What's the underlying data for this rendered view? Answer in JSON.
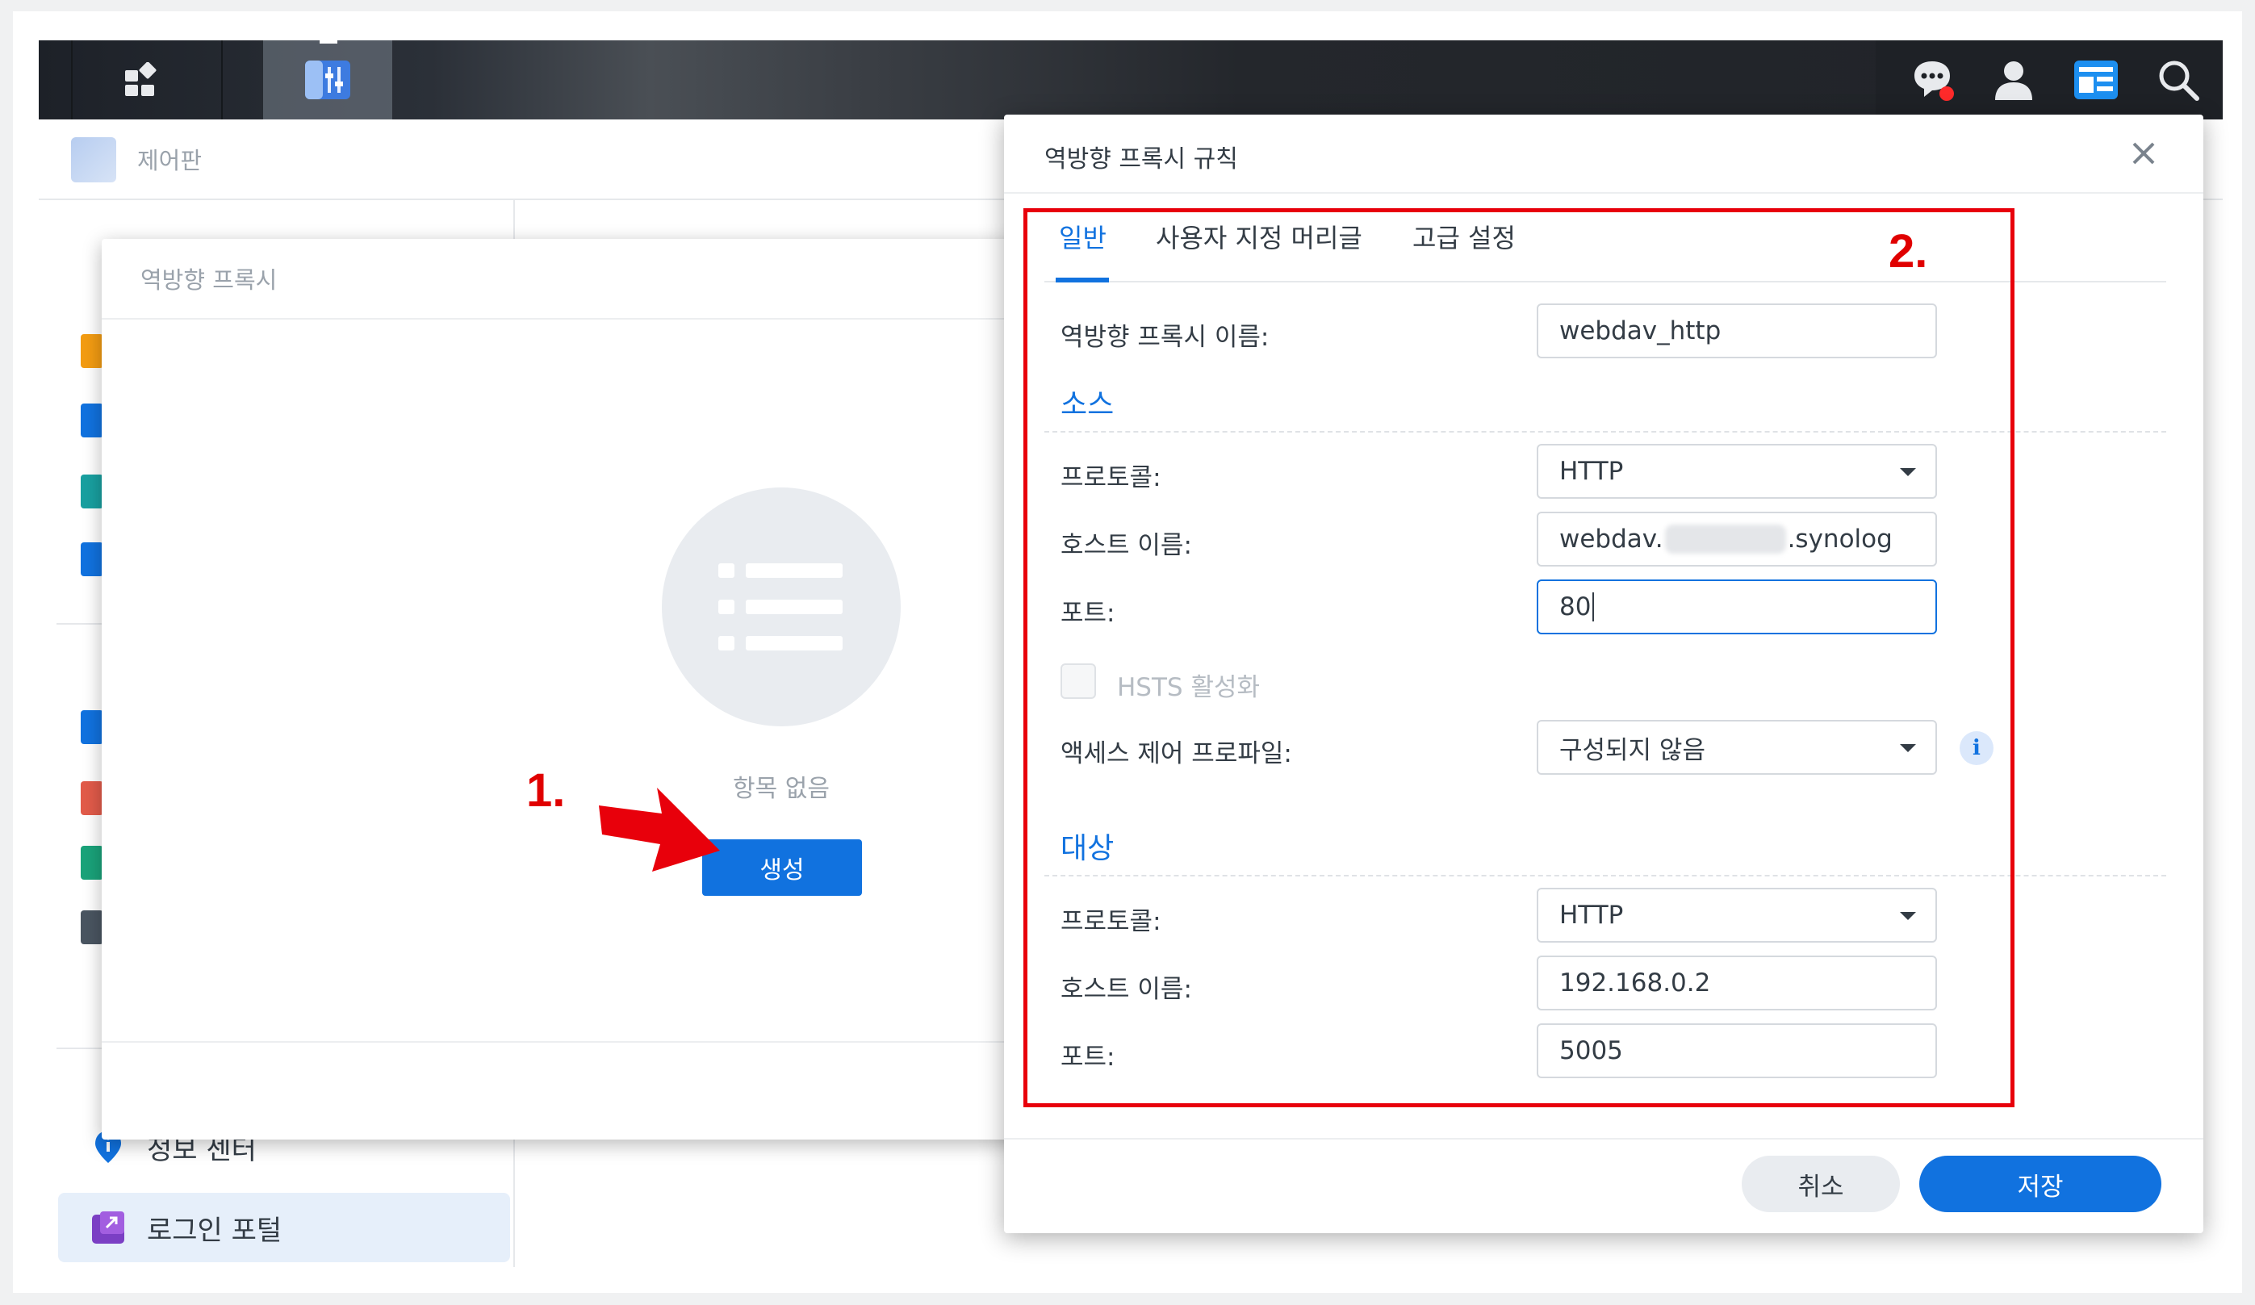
{
  "control_panel": {
    "title": "제어판"
  },
  "sidebar": {
    "items": [
      {
        "label": "정보 센터"
      },
      {
        "label": "로그인 포털"
      }
    ]
  },
  "proxy_list": {
    "title": "역방향 프록시",
    "empty_text": "항목 없음",
    "create_label": "생성"
  },
  "annotations": {
    "step1": "1.",
    "step2": "2."
  },
  "rule_dialog": {
    "title": "역방향 프록시 규칙",
    "tabs": [
      "일반",
      "사용자 지정 머리글",
      "고급 설정"
    ],
    "name_label": "역방향 프록시 이름:",
    "name_value": "webdav_http",
    "source": {
      "section": "소스",
      "protocol_label": "프로토콜:",
      "protocol_value": "HTTP",
      "host_label": "호스트 이름:",
      "host_prefix": "webdav.",
      "host_suffix": ".synolog",
      "port_label": "포트:",
      "port_value": "80",
      "hsts_label": "HSTS 활성화",
      "acl_label": "액세스 제어 프로파일:",
      "acl_value": "구성되지 않음"
    },
    "destination": {
      "section": "대상",
      "protocol_label": "프로토콜:",
      "protocol_value": "HTTP",
      "host_label": "호스트 이름:",
      "host_value": "192.168.0.2",
      "port_label": "포트:",
      "port_value": "5005"
    },
    "cancel_label": "취소",
    "save_label": "저장"
  },
  "colors": {
    "accent": "#1172df",
    "annotation": "#e8000b"
  }
}
